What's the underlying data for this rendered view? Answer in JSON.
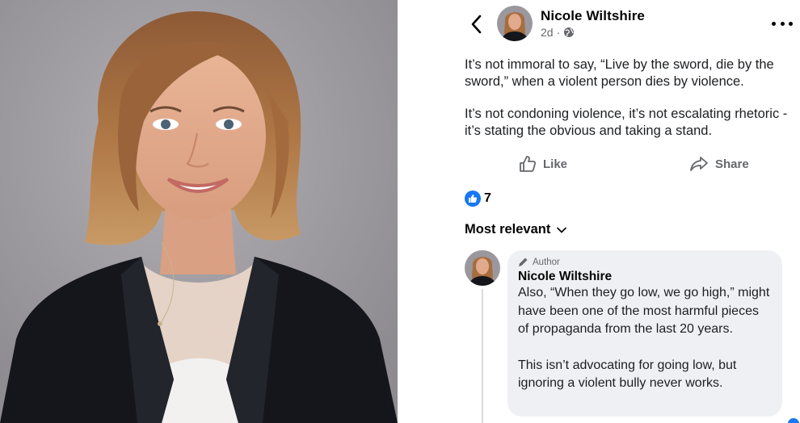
{
  "post": {
    "author_name": "Nicole Wiltshire",
    "time": "2d",
    "separator": "·",
    "audience_icon": "globe-icon",
    "paragraphs": [
      "It’s not immoral to say, “Live by the sword, die by the sword,” when a violent person dies by violence.",
      "It’s not condoning violence, it’s not escalating rhetoric - it’s stating the obvious and taking a stand."
    ]
  },
  "actions": {
    "like_label": "Like",
    "share_label": "Share"
  },
  "reactions": {
    "icon": "thumbs-up-icon",
    "count": "7"
  },
  "comments_sort": {
    "label": "Most relevant"
  },
  "comment": {
    "badge": "Author",
    "author_name": "Nicole Wiltshire",
    "paragraphs": [
      "Also, “When they go low, we go high,” might have been one of the most harmful pieces of propaganda from the last 20 years.",
      "This isn’t advocating for going low, but ignoring a violent bully never works."
    ]
  },
  "colors": {
    "link_blue": "#1877f2",
    "secondary_text": "#65676b",
    "comment_bubble": "#eff0f3",
    "jacket": "#15161b",
    "hair": "#a86d3f"
  }
}
